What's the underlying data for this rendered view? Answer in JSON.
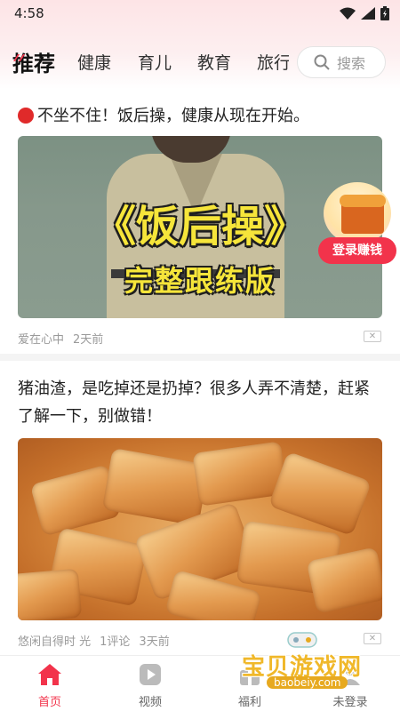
{
  "status_bar": {
    "time": "4:58"
  },
  "tabs": [
    {
      "label": "推荐",
      "active": true
    },
    {
      "label": "健康"
    },
    {
      "label": "育儿"
    },
    {
      "label": "教育"
    },
    {
      "label": "旅行"
    }
  ],
  "search": {
    "placeholder": "搜索"
  },
  "articles": [
    {
      "title": "不坐不住！饭后操，健康从现在开始。",
      "image_title": "《饭后操》",
      "image_subtitle": "完整跟练版",
      "author": "爱在心中",
      "time": "2天前",
      "close": "✕"
    },
    {
      "title": "猪油渣，是吃掉还是扔掉？很多人弄不清楚，赶紧了解一下，别做错！",
      "author": "悠闲自得时 光",
      "comments": "1评论",
      "time": "3天前",
      "close": "✕"
    }
  ],
  "promo": {
    "label": "登录赚钱"
  },
  "bottom_nav": [
    {
      "label": "首页",
      "icon": "home-icon",
      "active": true
    },
    {
      "label": "视频",
      "icon": "video-icon"
    },
    {
      "label": "福利",
      "icon": "gift-icon"
    },
    {
      "label": "未登录",
      "icon": "user-icon"
    }
  ],
  "watermark": {
    "text": "宝贝游戏网",
    "url": "baobeiy.com"
  },
  "colors": {
    "accent": "#f2334b",
    "poster_text": "#f6e53a",
    "meta": "#9a9a9a"
  }
}
